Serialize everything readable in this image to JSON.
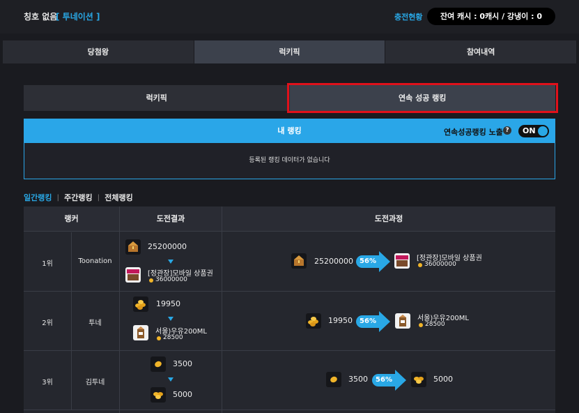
{
  "header": {
    "title_none": "칭호 없음",
    "title_tag": "[ 투네이션 ]",
    "charge_link": "충전현황",
    "balance": "잔여 캐시 : 0캐시 / 강냉이 : 0"
  },
  "main_tabs": [
    {
      "label": "당첨왕"
    },
    {
      "label": "럭키픽"
    },
    {
      "label": "참여내역"
    }
  ],
  "sub_tabs": [
    {
      "label": "럭키픽"
    },
    {
      "label": "연속 성공 랭킹"
    }
  ],
  "my_rank": {
    "title": "내 랭킹",
    "expose_label": "연속성공랭킹 노출",
    "help": "?",
    "toggle_label": "ON",
    "empty_text": "등록된 랭킹 데이터가 없습니다"
  },
  "period_tabs": [
    {
      "label": "일간랭킹"
    },
    {
      "label": "주간랭킹"
    },
    {
      "label": "전체랭킹"
    }
  ],
  "table": {
    "headers": {
      "ranker": "랭커",
      "result": "도전결과",
      "process": "도전과정"
    },
    "rows": [
      {
        "rank": "1위",
        "name": "Toonation",
        "start_value": "25200000",
        "percent": "56%",
        "prize_name": "[정관장]모바일 상품권",
        "prize_price": "36000000",
        "start_icon": "treasure-chest-icon",
        "prize_icon": "gift-card-icon"
      },
      {
        "rank": "2위",
        "name": "투네",
        "start_value": "19950",
        "percent": "56%",
        "prize_name": "서울)우유200ML",
        "prize_price": "28500",
        "start_icon": "coin-pile-icon",
        "prize_icon": "milk-icon"
      },
      {
        "rank": "3위",
        "name": "김투네",
        "start_value": "3500",
        "percent": "56%",
        "prize_name": "5000",
        "prize_price": "",
        "start_icon": "coin-icon",
        "prize_icon": "coins-icon"
      }
    ]
  },
  "colors": {
    "accent": "#29a8e6",
    "highlight": "#e0111b",
    "background": "#1a1b20"
  }
}
